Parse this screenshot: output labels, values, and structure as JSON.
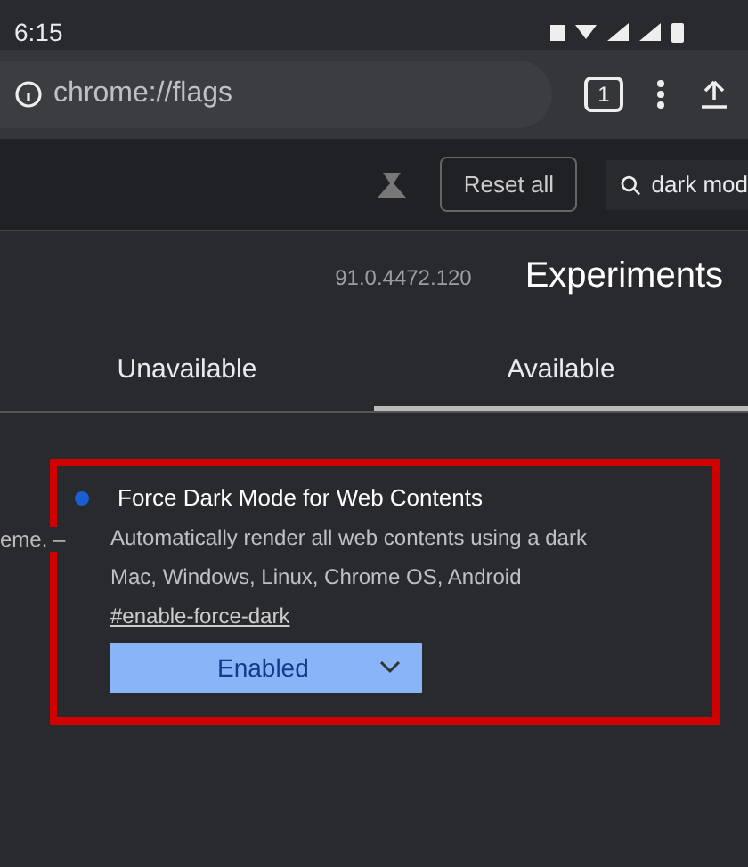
{
  "status_bar": {
    "time": "6:15"
  },
  "address_bar": {
    "url": "chrome://flags",
    "tab_count": "1"
  },
  "toolbar": {
    "reset_button": "Reset all",
    "search": {
      "value": "dark mod"
    }
  },
  "header": {
    "version": "91.0.4472.120",
    "title": "Experiments"
  },
  "tabs": [
    {
      "label": "Unavailable",
      "selected": false
    },
    {
      "label": "Available",
      "selected": true
    }
  ],
  "flags": [
    {
      "highlighted": true,
      "modified": true,
      "fragment": "eme. –",
      "title": "Force Dark Mode for Web Contents",
      "description": "Automatically render all web contents using a dark",
      "platforms": "Mac, Windows, Linux, Chrome OS, Android",
      "link": "#enable-force-dark",
      "value": "Enabled"
    }
  ]
}
